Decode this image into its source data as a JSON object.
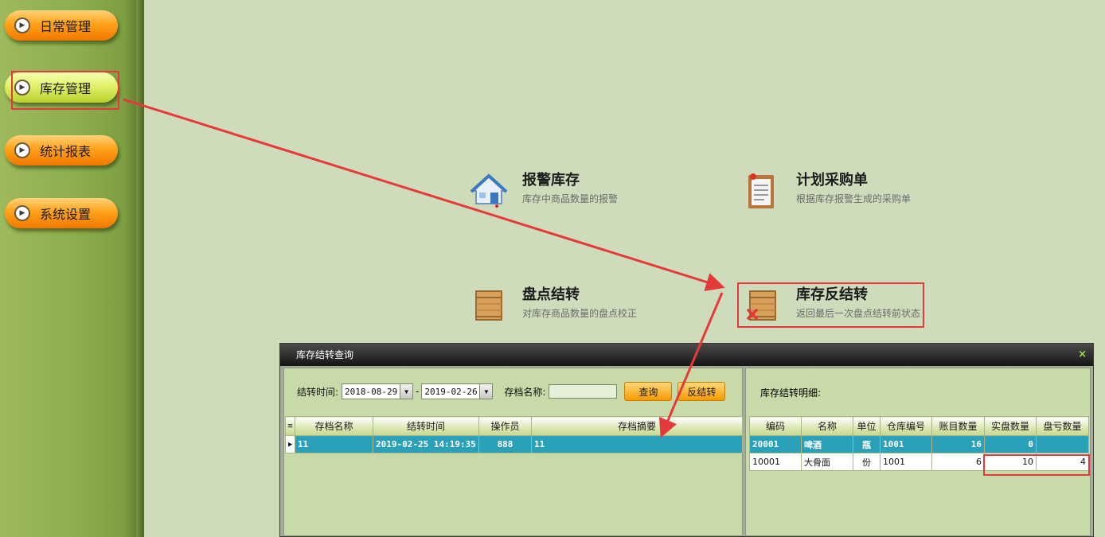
{
  "sidebar": {
    "items": [
      {
        "label": "日常管理"
      },
      {
        "label": "库存管理"
      },
      {
        "label": "统计报表"
      },
      {
        "label": "系统设置"
      }
    ]
  },
  "tiles": [
    {
      "title": "报警库存",
      "desc": "库存中商品数量的报警",
      "icon": "house-alarm-icon"
    },
    {
      "title": "计划采购单",
      "desc": "根据库存报警生成的采购单",
      "icon": "clipboard-icon"
    },
    {
      "title": "盘点结转",
      "desc": "对库存商品数量的盘点校正",
      "icon": "crate-icon"
    },
    {
      "title": "库存反结转",
      "desc": "返回最后一次盘点结转前状态",
      "icon": "crate-cancel-icon"
    }
  ],
  "dialog": {
    "title": "库存结转查询",
    "close": "×",
    "filter": {
      "time_label": "结转时间:",
      "date_from": "2018-08-29",
      "separator": "-",
      "date_to": "2019-02-26",
      "name_label": "存档名称:",
      "name_value": "",
      "query_btn": "查询",
      "reverse_btn": "反结转"
    },
    "left_table": {
      "columns": [
        "存档名称",
        "结转时间",
        "操作员",
        "存档摘要"
      ],
      "rows": [
        [
          "11",
          "2019-02-25 14:19:35",
          "888",
          "11"
        ]
      ]
    },
    "detail_label": "库存结转明细:",
    "right_table": {
      "columns": [
        "编码",
        "名称",
        "单位",
        "仓库编号",
        "账目数量",
        "实盘数量",
        "盘亏数量"
      ],
      "rows": [
        [
          "20001",
          "啤酒",
          "瓶",
          "1001",
          "16",
          "0",
          ""
        ],
        [
          "10001",
          "大骨面",
          "份",
          "1001",
          "6",
          "10",
          "4"
        ]
      ]
    }
  },
  "colors": {
    "highlight_red": "#e53a3a",
    "selected_row": "#2aa1b8",
    "orange_button": "#f59a00"
  }
}
